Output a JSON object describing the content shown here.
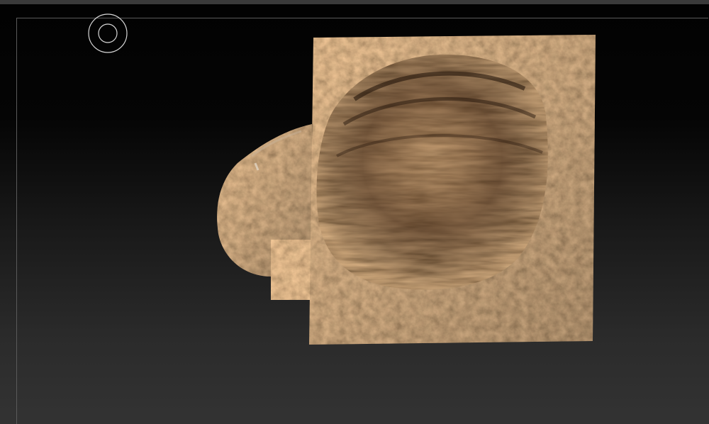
{
  "colors": {
    "background_top": "#020202",
    "background_bottom": "#333333",
    "frame_line": "#5a5a5a",
    "dirt_light": "#a47850",
    "dirt_mid": "#7a5433",
    "dirt_dark": "#2a1a0e"
  },
  "viewport": {
    "brush_cursor_icon": "brush-circle-icon",
    "model_name": ""
  }
}
